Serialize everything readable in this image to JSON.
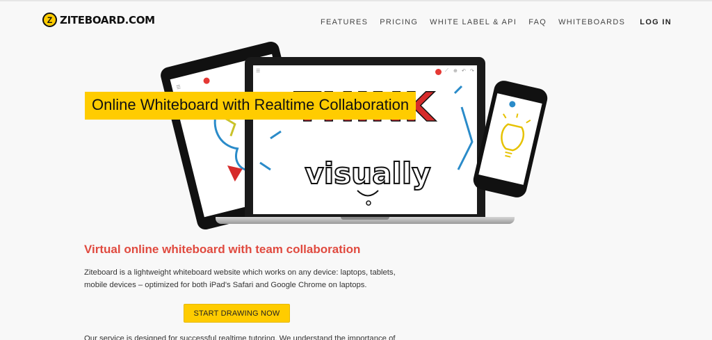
{
  "brand": {
    "name": "ZITEBOARD.COM",
    "mark": "Z"
  },
  "nav": {
    "items": [
      "FEATURES",
      "PRICING",
      "WHITE LABEL & API",
      "FAQ",
      "WHITEBOARDS"
    ],
    "login": "LOG IN"
  },
  "hero": {
    "headline": "Online Whiteboard with Realtime Collaboration",
    "art_word_1": "THINK",
    "art_word_2": "visually"
  },
  "content": {
    "subheading": "Virtual online whiteboard with team collaboration",
    "description": "Ziteboard is a lightweight whiteboard website which works on any device: laptops, tablets, mobile devices – optimized for both iPad's Safari and Google Chrome on laptops.",
    "cta_label": "START DRAWING NOW",
    "cutoff_text": "Our service is designed for successful realtime tutoring. We understand the importance of a"
  },
  "colors": {
    "accent": "#ffcc00",
    "subheading": "#e04a3f",
    "tool_red": "#e53935",
    "art_red": "#d62b2b",
    "art_blue": "#2a8bc9"
  }
}
